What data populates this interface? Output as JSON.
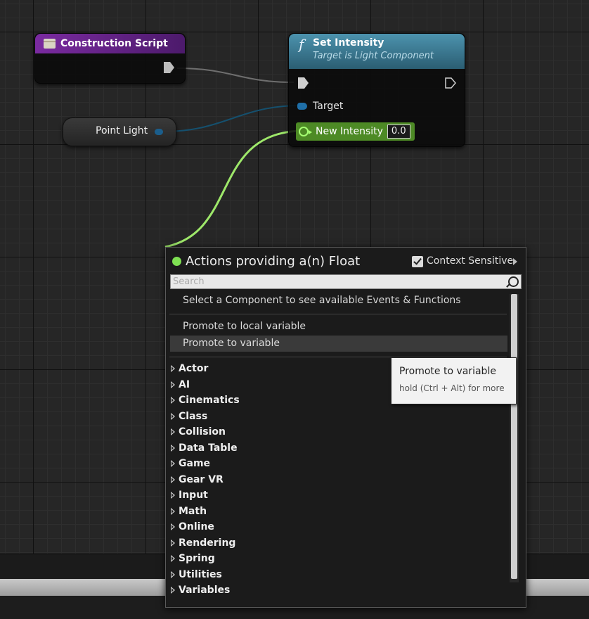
{
  "nodes": {
    "construction_script": {
      "title": "Construction Script"
    },
    "set_intensity": {
      "icon": "f",
      "title": "Set Intensity",
      "subtitle": "Target is Light Component",
      "target_label": "Target",
      "new_intensity_label": "New Intensity",
      "new_intensity_value": "0.0"
    },
    "point_light": {
      "label": "Point Light"
    }
  },
  "action_menu": {
    "title": "Actions providing a(n) Float",
    "context_sensitive_label": "Context Sensitive",
    "context_sensitive_checked": true,
    "search_placeholder": "Search",
    "hint": "Select a Component to see available Events & Functions",
    "actions": [
      "Promote to local variable",
      "Promote to variable"
    ],
    "highlighted_action": "Promote to variable",
    "categories": [
      "Actor",
      "AI",
      "Cinematics",
      "Class",
      "Collision",
      "Data Table",
      "Game",
      "Gear VR",
      "Input",
      "Math",
      "Online",
      "Rendering",
      "Spring",
      "Utilities",
      "Variables"
    ]
  },
  "tooltip": {
    "title": "Promote to variable",
    "subtitle": "hold (Ctrl + Alt) for more"
  },
  "colors": {
    "function_header": "#3d7b95",
    "event_header": "#6a2590",
    "float_pin": "#9bf25c",
    "object_pin": "#1f6fa8",
    "graph_bg": "#262626"
  }
}
